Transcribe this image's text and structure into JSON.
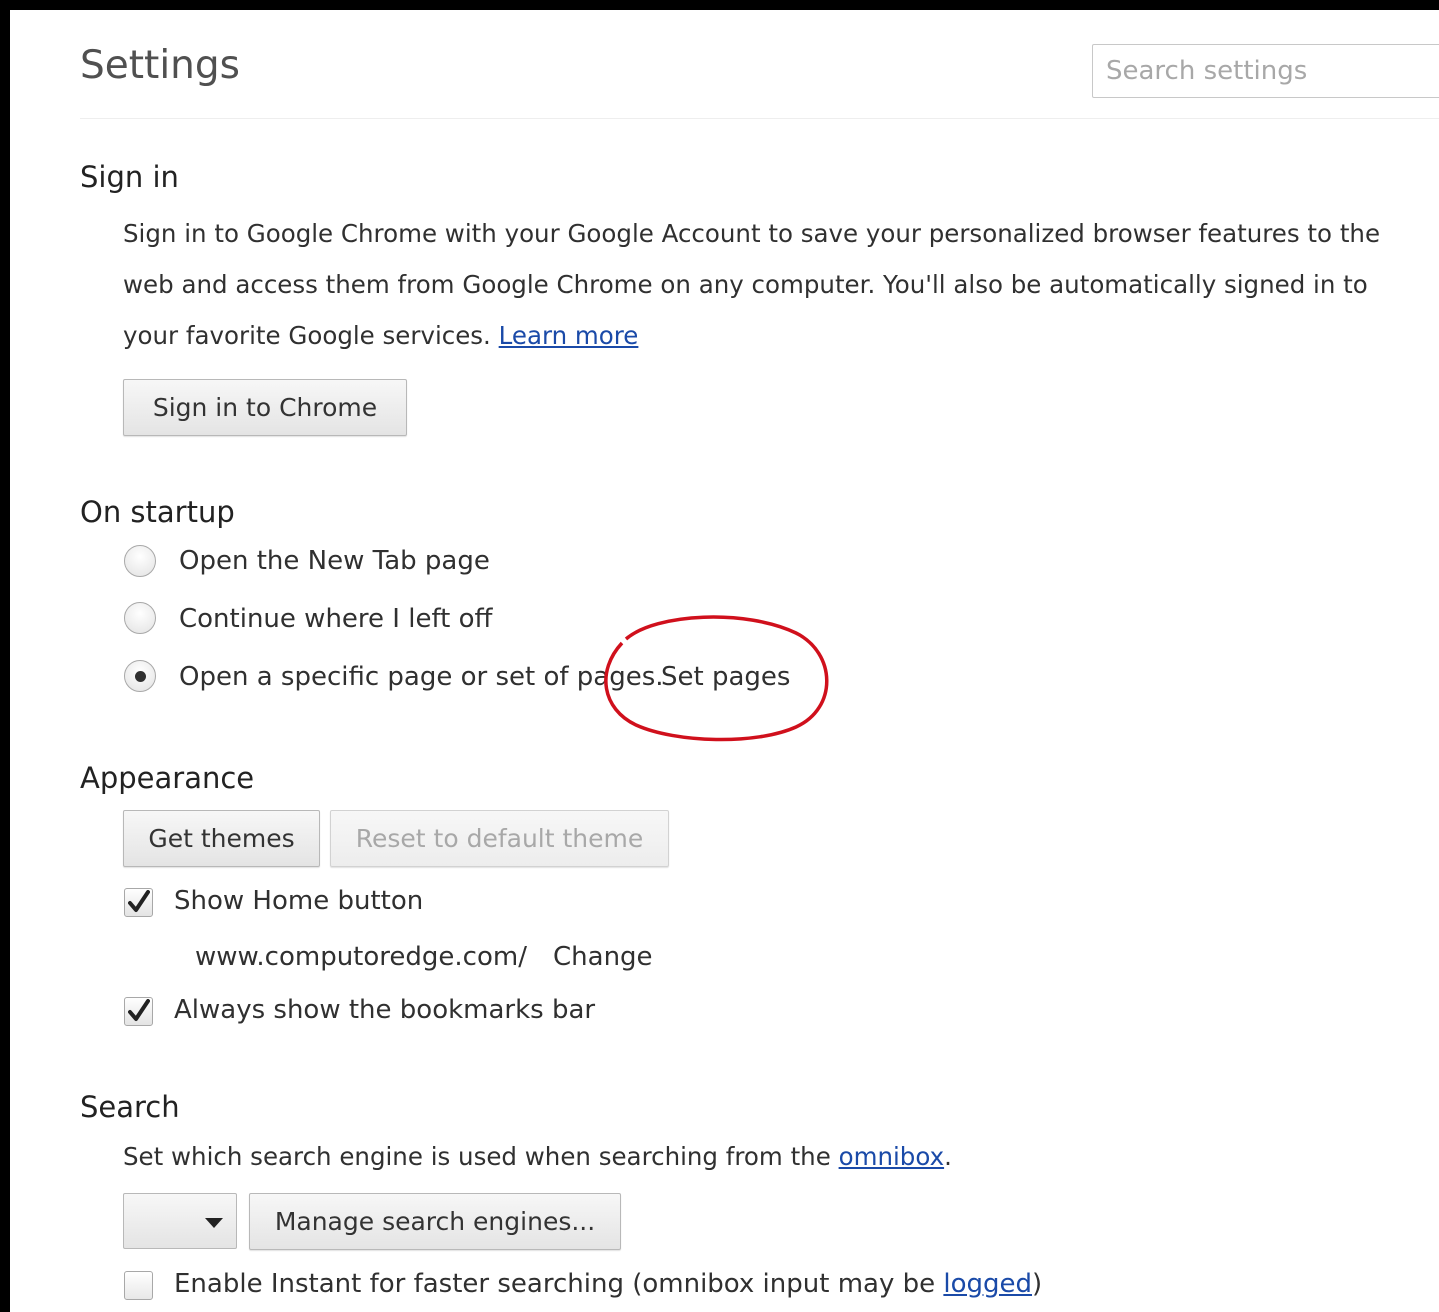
{
  "header": {
    "title": "Settings",
    "search_placeholder": "Search settings"
  },
  "sign_in": {
    "heading": "Sign in",
    "desc_line1": "Sign in to Google Chrome with your Google Account to save your personalized browser features to the",
    "desc_line2": "web and access them from Google Chrome on any computer. You'll also be automatically signed in to",
    "desc_line3": "your favorite Google services.",
    "learn_more": "Learn more",
    "button": "Sign in to Chrome"
  },
  "startup": {
    "heading": "On startup",
    "options": [
      {
        "label": "Open the New Tab page",
        "selected": false
      },
      {
        "label": "Continue where I left off",
        "selected": false
      },
      {
        "label": "Open a specific page or set of pages.",
        "selected": true
      }
    ],
    "set_pages": "Set pages"
  },
  "appearance": {
    "heading": "Appearance",
    "get_themes": "Get themes",
    "reset_theme": "Reset to default theme",
    "show_home": {
      "label": "Show Home button",
      "checked": true
    },
    "home_url": "www.computoredge.com/",
    "change": "Change",
    "bookmarks": {
      "label": "Always show the bookmarks bar",
      "checked": true
    }
  },
  "search": {
    "heading": "Search",
    "desc": "Set which search engine is used when searching from the",
    "omnibox_link": "omnibox",
    "desc_end": ".",
    "select_value": "",
    "manage_button": "Manage search engines...",
    "instant": {
      "label": "Enable Instant for faster searching (omnibox input may be",
      "link": "logged",
      "end": ")",
      "checked": false
    }
  },
  "colors": {
    "link": "#1a4aa8",
    "annotation": "#d0101c"
  },
  "icons": {
    "dropdown": "caret-down-icon",
    "checkmark": "checkmark-icon",
    "annotation": "red-ellipse-annotation"
  }
}
